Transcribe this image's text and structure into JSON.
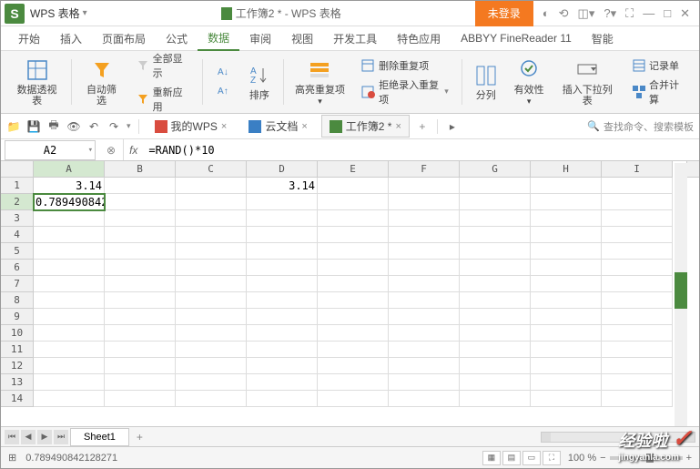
{
  "app": {
    "name": "WPS 表格",
    "doc_title": "工作簿2 * - WPS 表格",
    "login": "未登录"
  },
  "menu": {
    "items": [
      "开始",
      "插入",
      "页面布局",
      "公式",
      "数据",
      "审阅",
      "视图",
      "开发工具",
      "特色应用",
      "ABBYY FineReader 11",
      "智能"
    ],
    "active_index": 4
  },
  "ribbon": {
    "pivot": "数据透视表",
    "autofilter": "自动筛选",
    "showall": "全部显示",
    "reapply": "重新应用",
    "sort": "排序",
    "highlight": "高亮重复项",
    "remove_dup": "删除重复项",
    "reject_dup": "拒绝录入重复项",
    "text_to_col": "分列",
    "validation": "有效性",
    "insert_dropdown": "插入下拉列表",
    "record_form": "记录单",
    "consolidate": "合并计算"
  },
  "doctabs": {
    "wps": "我的WPS",
    "cloud": "云文档",
    "workbook": "工作簿2 *"
  },
  "search": {
    "placeholder": "查找命令、搜索模板"
  },
  "formula": {
    "cell_ref": "A2",
    "fx": "fx",
    "content": "=RAND()*10"
  },
  "grid": {
    "cols": [
      "A",
      "B",
      "C",
      "D",
      "E",
      "F",
      "G",
      "H",
      "I"
    ],
    "rows": [
      "1",
      "2",
      "3",
      "4",
      "5",
      "6",
      "7",
      "8",
      "9",
      "10",
      "11",
      "12",
      "13",
      "14"
    ],
    "selected": {
      "row": 1,
      "col": 0
    },
    "cells": {
      "A1": "3.14",
      "A2": "0.789490842",
      "D1": "3.14"
    }
  },
  "sheet": {
    "name": "Sheet1",
    "add": "+"
  },
  "status": {
    "value": "0.789490842128271",
    "zoom": "100 %"
  },
  "watermark": {
    "main": "经验啦",
    "sub": "jingyanla.com"
  },
  "chart_data": null
}
